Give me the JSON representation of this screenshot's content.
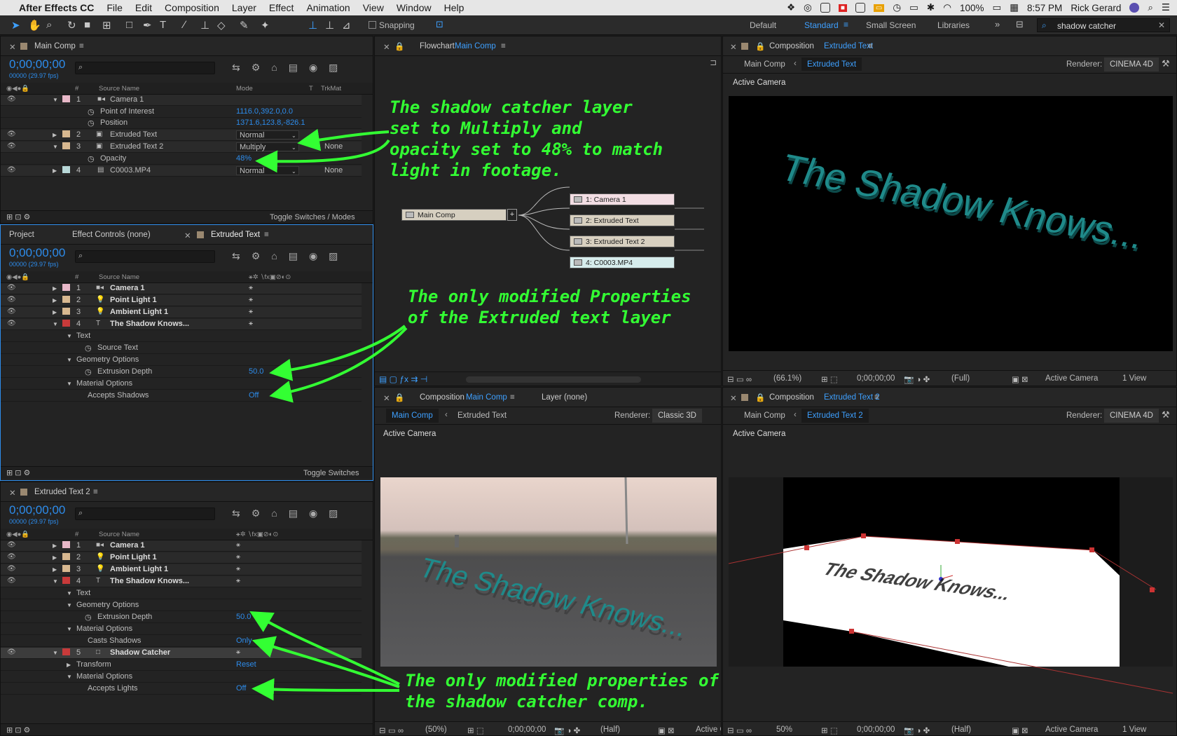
{
  "menubar": {
    "app": "After Effects CC",
    "items": [
      "File",
      "Edit",
      "Composition",
      "Layer",
      "Effect",
      "Animation",
      "View",
      "Window",
      "Help"
    ],
    "battery": "100%",
    "time": "8:57 PM",
    "user": "Rick Gerard"
  },
  "toolbar": {
    "snapping": "Snapping",
    "workspaces": [
      "Default",
      "Standard",
      "Small Screen",
      "Libraries"
    ],
    "search_value": "shadow catcher"
  },
  "tl1": {
    "title": "Main Comp",
    "timecode": "0;00;00;00",
    "fps": "00000 (29.97 fps)",
    "cols": {
      "num": "#",
      "source": "Source Name",
      "mode": "Mode",
      "t": "T",
      "trkmat": "TrkMat"
    },
    "rows": [
      {
        "n": "1",
        "name": "Camera 1"
      },
      {
        "prop": "Point of Interest",
        "val": "1116.0,392.0,0.0"
      },
      {
        "prop": "Position",
        "val": "1371.6,123.8,-826.1"
      },
      {
        "n": "2",
        "name": "Extruded Text",
        "mode": "Normal"
      },
      {
        "n": "3",
        "name": "Extruded Text 2",
        "mode": "Multiply",
        "trk": "None"
      },
      {
        "prop": "Opacity",
        "val": "48%"
      },
      {
        "n": "4",
        "name": "C0003.MP4",
        "mode": "Normal",
        "trk": "None"
      }
    ],
    "footer": "Toggle Switches / Modes"
  },
  "tl2": {
    "tabs": [
      "Project",
      "Effect Controls (none)",
      "Extruded Text"
    ],
    "timecode": "0;00;00;00",
    "fps": "00000 (29.97 fps)",
    "cols": {
      "num": "#",
      "source": "Source Name"
    },
    "rows": [
      {
        "n": "1",
        "name": "Camera 1"
      },
      {
        "n": "2",
        "name": "Point Light 1"
      },
      {
        "n": "3",
        "name": "Ambient Light 1"
      },
      {
        "n": "4",
        "name": "The Shadow Knows..."
      },
      {
        "g": "Text"
      },
      {
        "prop": "Source Text"
      },
      {
        "g": "Geometry Options"
      },
      {
        "prop": "Extrusion Depth",
        "val": "50.0"
      },
      {
        "g": "Material Options"
      },
      {
        "prop": "Accepts Shadows",
        "val": "Off"
      }
    ],
    "footer": "Toggle Switches"
  },
  "tl3": {
    "title": "Extruded Text 2",
    "timecode": "0;00;00;00",
    "fps": "00000 (29.97 fps)",
    "cols": {
      "num": "#",
      "source": "Source Name"
    },
    "rows": [
      {
        "n": "1",
        "name": "Camera 1"
      },
      {
        "n": "2",
        "name": "Point Light 1"
      },
      {
        "n": "3",
        "name": "Ambient Light 1"
      },
      {
        "n": "4",
        "name": "The Shadow Knows..."
      },
      {
        "g": "Text"
      },
      {
        "g": "Geometry Options"
      },
      {
        "prop": "Extrusion Depth",
        "val": "50.0"
      },
      {
        "g": "Material Options"
      },
      {
        "prop": "Casts Shadows",
        "val": "Only"
      },
      {
        "n": "5",
        "name": "Shadow Catcher"
      },
      {
        "g": "Transform",
        "val": "Reset"
      },
      {
        "g": "Material Options"
      },
      {
        "prop": "Accepts Lights",
        "val": "Off"
      }
    ]
  },
  "flow": {
    "label": "Flowchart",
    "comp": "Main Comp",
    "main_node": "Main Comp",
    "nodes": [
      "1: Camera 1",
      "2: Extruded Text",
      "3: Extruded Text 2",
      "4: C0003.MP4"
    ]
  },
  "comp_tr": {
    "label": "Composition",
    "comp": "Extruded Text",
    "crumb1": "Main Comp",
    "crumb2": "Extruded Text",
    "renderer_label": "Renderer:",
    "renderer": "CINEMA 4D",
    "camera": "Active Camera",
    "text": "The Shadow Knows...",
    "bar": {
      "zoom": "(66.1%)",
      "tc": "0;00;00;00",
      "res": "(Full)",
      "cam": "Active Camera",
      "view": "1 View"
    }
  },
  "comp_bl": {
    "label": "Composition",
    "comp": "Main Comp",
    "layer_tab": "Layer (none)",
    "crumb1": "Main Comp",
    "crumb2": "Extruded Text",
    "renderer_label": "Renderer:",
    "renderer": "Classic 3D",
    "camera": "Active Camera",
    "text": "The Shadow Knows...",
    "bar": {
      "zoom": "(50%)",
      "tc": "0;00;00;00",
      "res": "(Half)",
      "cam": "Active C"
    }
  },
  "comp_br": {
    "label": "Composition",
    "comp": "Extruded Text 2",
    "crumb1": "Main Comp",
    "crumb2": "Extruded Text 2",
    "renderer_label": "Renderer:",
    "renderer": "CINEMA 4D",
    "camera": "Active Camera",
    "text": "The Shadow Knows...",
    "bar": {
      "zoom": "50%",
      "tc": "0;00;00;00",
      "res": "(Half)",
      "cam": "Active Camera",
      "view": "1 View"
    }
  },
  "notes": {
    "n1": "The shadow catcher layer\nset to Multiply and\nopacity set to 48% to match\nlight in footage.",
    "n2": "The only modified Properties\nof the Extruded text layer",
    "n3": "The only modified properties of\nthe shadow catcher comp."
  },
  "colors": {
    "accent": "#2d8ceb",
    "annotation": "#33ff33",
    "text3d": "#1f8a8a"
  }
}
